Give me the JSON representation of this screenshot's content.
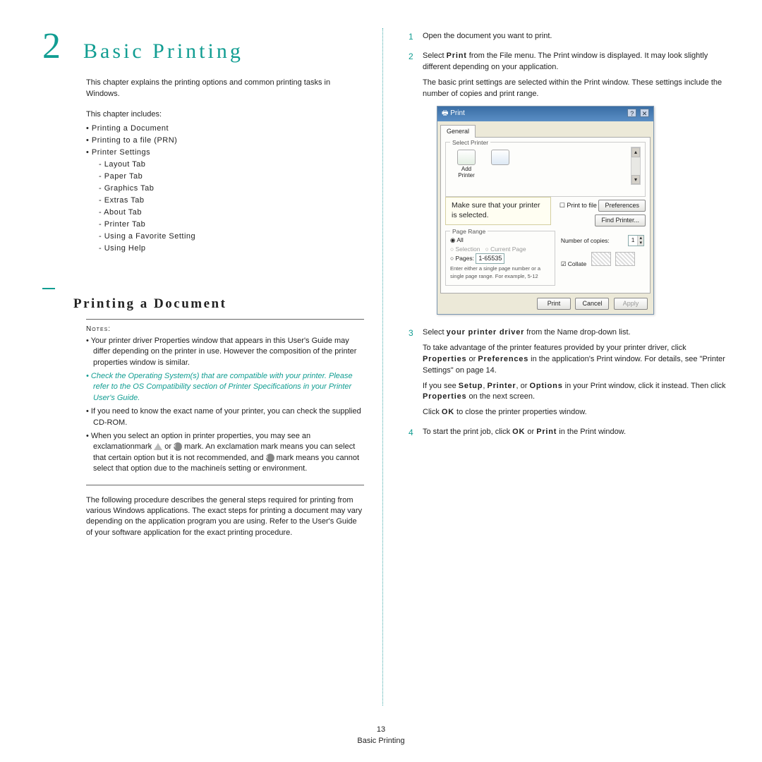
{
  "chapter": {
    "number": "2",
    "title": "Basic Printing"
  },
  "intro": "This chapter explains the printing options and common printing tasks in Windows.",
  "includes_label": "This chapter includes:",
  "toc": {
    "items": [
      "Printing a Document",
      "Printing to a file (PRN)",
      "Printer Settings"
    ],
    "subitems": [
      "Layout Tab",
      "Paper Tab",
      "Graphics Tab",
      "Extras Tab",
      "About Tab",
      "Printer Tab",
      "Using a Favorite Setting",
      "Using Help"
    ]
  },
  "section1": {
    "title": "Printing a Document"
  },
  "notes": {
    "label": "Notes:",
    "n1": "Your printer driver Properties window that appears in this User's Guide may differ depending on the printer in use. However the composition of the printer properties window is similar.",
    "n2": "Check the Operating System(s) that are compatible with your printer. Please refer to the OS Compatibility section of Printer Specifications in your Printer User's Guide.",
    "n3": "If you need to know the exact name of your printer, you can check the supplied CD-ROM.",
    "n4a": "When you select an option in printer properties, you may see an exclamationmark ",
    "n4b": " or ",
    "n4c": " mark. An exclamation mark means you can select that certain option but it is not recommended, and ",
    "n4d": " mark means you cannot select that option due to the machineís setting or environment."
  },
  "following": "The following procedure describes the general steps required for printing from various Windows applications. The exact steps for printing a document may vary depending on the application program you are using. Refer to the User's Guide of your software application for the exact printing procedure.",
  "steps": {
    "s1": "Open the document you want to print.",
    "s2a": "Select ",
    "s2b": "Print",
    "s2c": " from the File menu. The Print window is displayed. It may look slightly different depending on your application.",
    "s2p2": "The basic print settings are selected within the Print window. These settings include the number of copies and print range.",
    "s3a": "Select ",
    "s3b": "your printer driver",
    "s3c": " from the Name drop-down list.",
    "s3p2a": "To take advantage of the printer features provided by your printer driver, click ",
    "s3p2b": "Properties",
    "s3p2c": " or ",
    "s3p2d": "Preferences",
    "s3p2e": " in the application's Print window. For details, see \"Printer Settings\" on page 14.",
    "s3p3a": "If you see ",
    "s3p3b": "Setup",
    "s3p3c": ", ",
    "s3p3d": "Printer",
    "s3p3e": ", or ",
    "s3p3f": "Options",
    "s3p3g": " in your Print window, click it instead. Then click ",
    "s3p3h": "Properties",
    "s3p3i": " on the next screen.",
    "s3p4a": "Click ",
    "s3p4b": "OK",
    "s3p4c": " to close the printer properties window.",
    "s4a": "To start the print job, click ",
    "s4b": "OK",
    "s4c": " or ",
    "s4d": "Print",
    "s4e": " in the Print window."
  },
  "dialog": {
    "title": "Print",
    "tab": "General",
    "grp_printer": "Select Printer",
    "add_printer": "Add Printer",
    "callout": "Make sure that your printer is selected.",
    "print_to_file": "Print to file",
    "preferences": "Preferences",
    "find_printer": "Find Printer...",
    "grp_range": "Page Range",
    "all": "All",
    "selection": "Selection",
    "current": "Current Page",
    "pages": "Pages:",
    "pages_val": "1-65535",
    "range_hint": "Enter either a single page number or a single page range. For example, 5-12",
    "copies_label": "Number of copies:",
    "copies_val": "1",
    "collate": "Collate",
    "btn_print": "Print",
    "btn_cancel": "Cancel",
    "btn_apply": "Apply"
  },
  "footer": {
    "page": "13",
    "label": "Basic Printing"
  }
}
